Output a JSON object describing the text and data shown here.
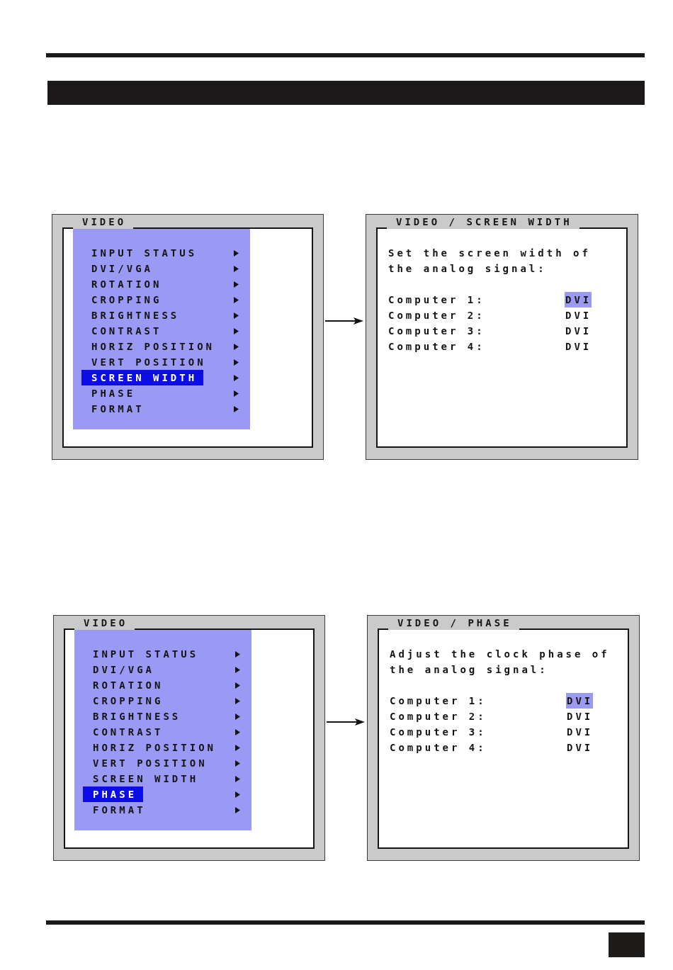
{
  "figures": [
    {
      "menu": {
        "title": "VIDEO",
        "items": [
          {
            "label": "INPUT STATUS",
            "selected": false
          },
          {
            "label": "DVI/VGA",
            "selected": false
          },
          {
            "label": "ROTATION",
            "selected": false
          },
          {
            "label": "CROPPING",
            "selected": false
          },
          {
            "label": "BRIGHTNESS",
            "selected": false
          },
          {
            "label": "CONTRAST",
            "selected": false
          },
          {
            "label": "HORIZ POSITION",
            "selected": false
          },
          {
            "label": "VERT POSITION",
            "selected": false
          },
          {
            "label": "SCREEN WIDTH",
            "selected": true
          },
          {
            "label": "PHASE",
            "selected": false
          },
          {
            "label": "FORMAT",
            "selected": false
          }
        ]
      },
      "detail": {
        "title": "VIDEO / SCREEN WIDTH",
        "description": "Set the screen width of the analog signal:",
        "rows": [
          {
            "label": "Computer 1:",
            "value": "DVI",
            "selected": true
          },
          {
            "label": "Computer 2:",
            "value": "DVI",
            "selected": false
          },
          {
            "label": "Computer 3:",
            "value": "DVI",
            "selected": false
          },
          {
            "label": "Computer 4:",
            "value": "DVI",
            "selected": false
          }
        ]
      }
    },
    {
      "menu": {
        "title": "VIDEO",
        "items": [
          {
            "label": "INPUT STATUS",
            "selected": false
          },
          {
            "label": "DVI/VGA",
            "selected": false
          },
          {
            "label": "ROTATION",
            "selected": false
          },
          {
            "label": "CROPPING",
            "selected": false
          },
          {
            "label": "BRIGHTNESS",
            "selected": false
          },
          {
            "label": "CONTRAST",
            "selected": false
          },
          {
            "label": "HORIZ POSITION",
            "selected": false
          },
          {
            "label": "VERT POSITION",
            "selected": false
          },
          {
            "label": "SCREEN WIDTH",
            "selected": false
          },
          {
            "label": "PHASE",
            "selected": true
          },
          {
            "label": "FORMAT",
            "selected": false
          }
        ]
      },
      "detail": {
        "title": "VIDEO / PHASE",
        "description": "Adjust the clock phase of the analog signal:",
        "rows": [
          {
            "label": "Computer 1:",
            "value": "DVI",
            "selected": true
          },
          {
            "label": "Computer 2:",
            "value": "DVI",
            "selected": false
          },
          {
            "label": "Computer 3:",
            "value": "DVI",
            "selected": false
          },
          {
            "label": "Computer 4:",
            "value": "DVI",
            "selected": false
          }
        ]
      }
    }
  ]
}
